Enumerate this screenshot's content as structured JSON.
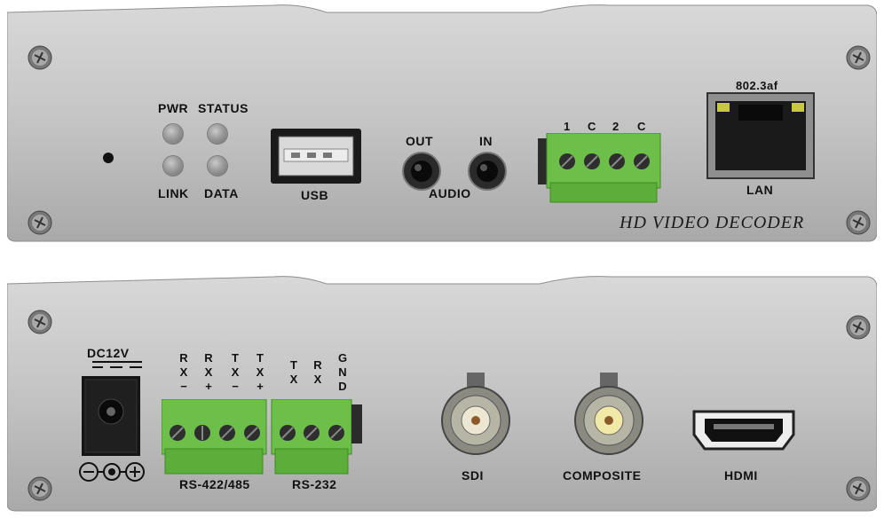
{
  "front_panel": {
    "led_labels": {
      "pwr": "PWR",
      "status": "STATUS",
      "link": "LINK",
      "data": "DATA"
    },
    "usb_label": "USB",
    "audio": {
      "out": "OUT",
      "in": "IN",
      "label": "AUDIO"
    },
    "terminal_labels": [
      "1",
      "C",
      "2",
      "C"
    ],
    "lan": {
      "standard": "802.3af",
      "label": "LAN"
    },
    "brand_text": "HD VIDEO DECODER"
  },
  "rear_panel": {
    "power": {
      "label": "DC12V"
    },
    "rs422_columns": [
      [
        "R",
        "X",
        "−"
      ],
      [
        "R",
        "X",
        "+"
      ],
      [
        "T",
        "X",
        "−"
      ],
      [
        "T",
        "X",
        "+"
      ]
    ],
    "rs232_columns": [
      [
        "T",
        "X"
      ],
      [
        "R",
        "X"
      ],
      [
        "G",
        "N",
        "D"
      ]
    ],
    "rs422_label": "RS-422/485",
    "rs232_label": "RS-232",
    "sdi_label": "SDI",
    "composite_label": "COMPOSITE",
    "hdmi_label": "HDMI"
  },
  "colors": {
    "panel": "#c4c4c4",
    "terminal_green": "#6cc04a",
    "port_black": "#111111"
  }
}
